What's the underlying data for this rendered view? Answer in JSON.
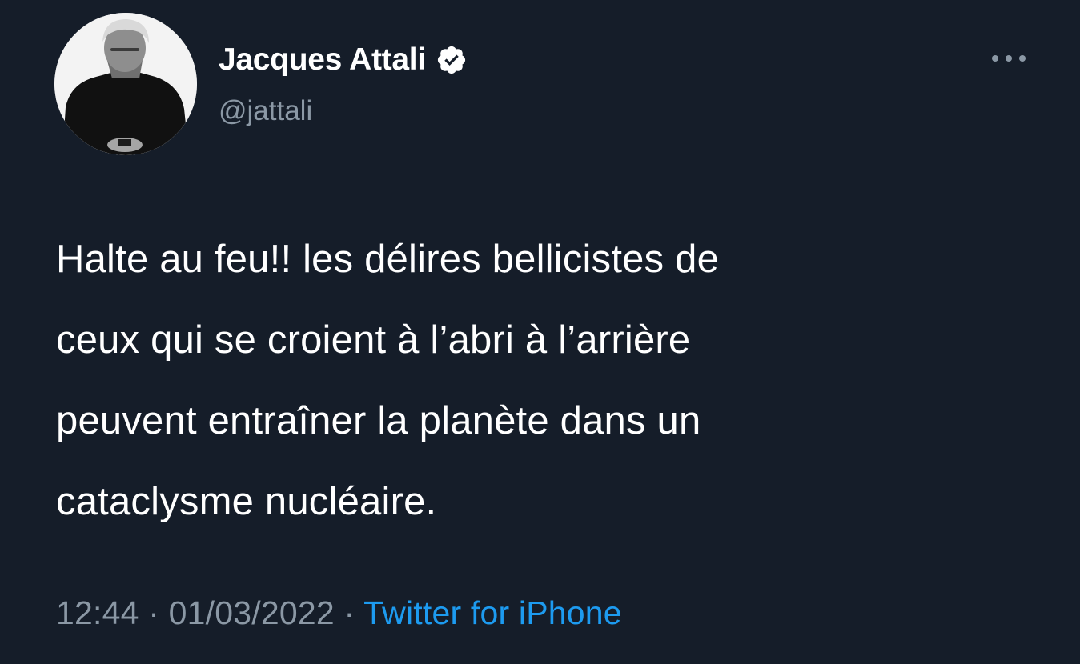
{
  "author": {
    "display_name": "Jacques Attali",
    "handle": "@jattali",
    "verified": true,
    "avatar_icon": "profile-photo"
  },
  "tweet": {
    "text": "Halte au feu!! les délires bellicistes de\nceux qui se croient à l’abri à l’arrière\npeuvent entraîner la planète dans un\ncataclysme nucléaire."
  },
  "meta": {
    "time": "12:44",
    "separator": " · ",
    "date": "01/03/2022",
    "source": "Twitter for iPhone"
  },
  "icons": {
    "verified": "verified-badge-icon",
    "more": "more-options-icon"
  },
  "colors": {
    "background": "#151d29",
    "text_primary": "#ffffff",
    "text_secondary": "#8b98a5",
    "link": "#1d9bf0"
  }
}
